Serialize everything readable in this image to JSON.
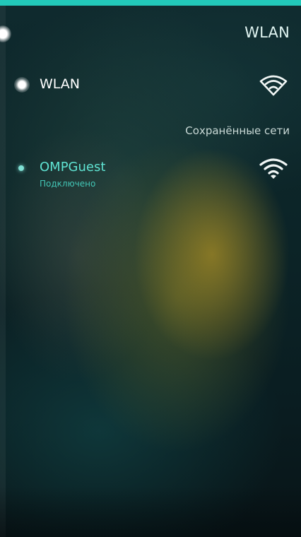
{
  "header": {
    "title": "WLAN"
  },
  "wlan_toggle": {
    "label": "WLAN",
    "enabled": true,
    "icon": "wifi-outline-icon"
  },
  "saved_networks": {
    "header": "Сохранённые сети",
    "items": [
      {
        "ssid": "OMPGuest",
        "status": "Подключено",
        "connected": true,
        "icon": "wifi-signal-icon"
      }
    ]
  },
  "colors": {
    "accent": "#22c9ba",
    "highlight_text": "#5fe3d2",
    "primary_text": "#ffffff"
  }
}
